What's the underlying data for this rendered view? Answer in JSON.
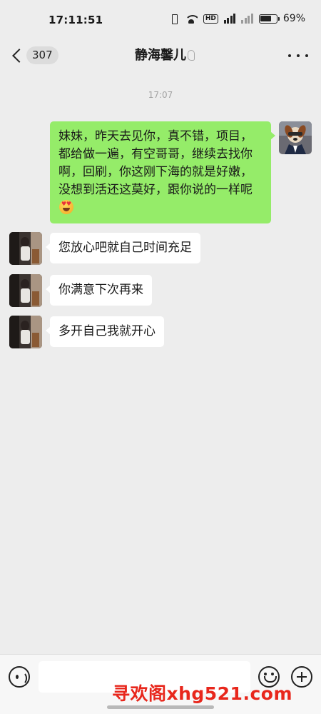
{
  "status_bar": {
    "time": "17:11:51",
    "battery_percent": "69%",
    "battery_level": 0.69,
    "icons": [
      "vibrate-icon",
      "wifi-icon",
      "hd-icon",
      "5g-signal-icon",
      "signal-icon",
      "battery-icon"
    ],
    "hd_label": "HD"
  },
  "nav": {
    "unread_count": "307",
    "title": "静海馨儿",
    "icons": [
      "back-arrow-icon",
      "ear-icon",
      "more-dots-icon"
    ]
  },
  "chat": {
    "timestamp": "17:07",
    "messages": [
      {
        "side": "right",
        "text": "妹妹，昨天去见你，真不错，项目，都给做一遍，有空哥哥，继续去找你啊，回刷，你这刚下海的就是好嫩，没想到活还这莫好，跟你说的一样呢",
        "emoji": "heart-eyes-emoji"
      },
      {
        "side": "left",
        "text": "您放心吧就自己时间充足"
      },
      {
        "side": "left",
        "text": "你满意下次再来"
      },
      {
        "side": "left",
        "text": "多开自己我就开心"
      }
    ]
  },
  "input_bar": {
    "placeholder": "",
    "icons": [
      "voice-icon",
      "emoji-icon",
      "plus-icon"
    ]
  },
  "watermark": "寻欢阁xhg521.com",
  "colors": {
    "background": "#ededed",
    "sent_bubble": "#95ec69",
    "received_bubble": "#ffffff",
    "watermark": "#e8271c"
  }
}
